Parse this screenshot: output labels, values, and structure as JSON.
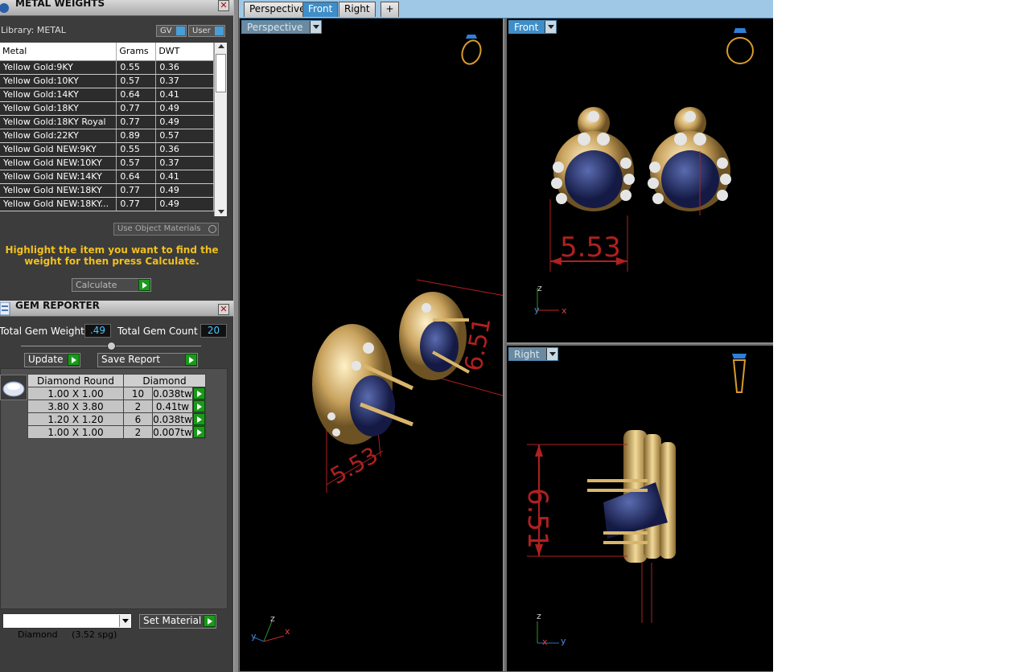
{
  "metal_panel": {
    "title": "METAL WEIGHTS",
    "library_label": "Library: METAL",
    "gv_label": "GV",
    "user_label": "User",
    "columns": [
      "Metal",
      "Grams",
      "DWT"
    ],
    "rows": [
      [
        "Yellow Gold:9KY",
        "0.55",
        "0.36"
      ],
      [
        "Yellow Gold:10KY",
        "0.57",
        "0.37"
      ],
      [
        "Yellow Gold:14KY",
        "0.64",
        "0.41"
      ],
      [
        "Yellow Gold:18KY",
        "0.77",
        "0.49"
      ],
      [
        "Yellow Gold:18KY Royal",
        "0.77",
        "0.49"
      ],
      [
        "Yellow Gold:22KY",
        "0.89",
        "0.57"
      ],
      [
        "Yellow Gold NEW:9KY",
        "0.55",
        "0.36"
      ],
      [
        "Yellow Gold NEW:10KY",
        "0.57",
        "0.37"
      ],
      [
        "Yellow Gold NEW:14KY",
        "0.64",
        "0.41"
      ],
      [
        "Yellow Gold NEW:18KY",
        "0.77",
        "0.49"
      ],
      [
        "Yellow Gold NEW:18KY...",
        "0.77",
        "0.49"
      ]
    ],
    "use_object_materials": "Use Object Materials",
    "instruction": "Highlight the item you want to find the weight for then press Calculate.",
    "calculate_label": "Calculate"
  },
  "gem_panel": {
    "title": "GEM REPORTER",
    "total_weight_label": "Total Gem Weight",
    "total_weight_value": ".49",
    "total_count_label": "Total Gem Count",
    "total_count_value": "20",
    "update_label": "Update",
    "save_report_label": "Save Report",
    "columns": [
      "Diamond Round",
      "Diamond"
    ],
    "rows": [
      [
        "1.00 X 1.00",
        "10",
        "0.038tw"
      ],
      [
        "3.80 X 3.80",
        "2",
        "0.41tw"
      ],
      [
        "1.20 X 1.20",
        "6",
        "0.038tw"
      ],
      [
        "1.00 X 1.00",
        "2",
        "0.007tw"
      ]
    ],
    "material_select": "Diamond     (3.52 spg)",
    "set_material_label": "Set Material"
  },
  "tabs": [
    "Perspective",
    "Front",
    "Right",
    "+"
  ],
  "active_tab": "Front",
  "viewports": {
    "perspective": "Perspective",
    "front": "Front",
    "right": "Right"
  },
  "dimensions": {
    "width": "5.53",
    "height": "6.51"
  },
  "axes": {
    "z": "z",
    "y": "y",
    "x": "x"
  },
  "colors": {
    "accent": "#3e8ec9",
    "gold": "#c9a35e",
    "gem": "#1c2a66",
    "dim_line": "#b02020",
    "instruction": "#f0c020"
  }
}
